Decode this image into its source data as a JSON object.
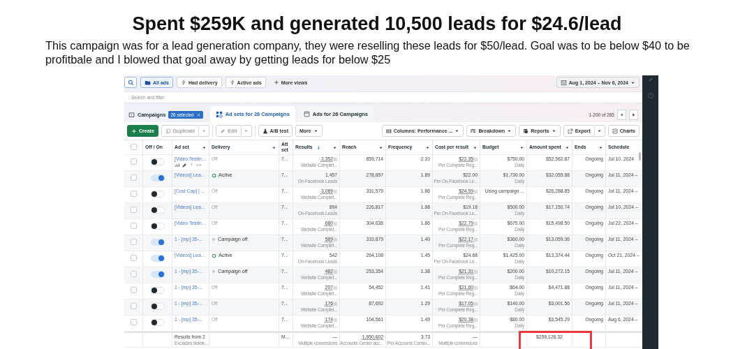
{
  "heading": {
    "title": "Spent $259K and generated 10,500 leads for $24.6/lead",
    "body": "This campaign was for a lead generation company, they were reselling these leads for $50/lead. Goal was to be below $40 to be profitbale and I blowed that goal away by getting leads for below $25"
  },
  "toolbar": {
    "views": [
      {
        "label": "All ads",
        "selected": true
      },
      {
        "label": "Had delivery",
        "selected": false
      },
      {
        "label": "Active ads",
        "selected": false
      },
      {
        "label": "More views",
        "selected": false
      }
    ],
    "date_range": "Aug 1, 2024 – Nov 6, 2024",
    "search": {
      "placeholder": "Search and filter"
    }
  },
  "tabs": {
    "campaigns": {
      "label": "Campaigns",
      "badge": "26 selected"
    },
    "items": [
      {
        "label": "Ad sets for 26 Campaigns",
        "selected": true
      },
      {
        "label": "Ads for 26 Campaigns",
        "selected": false
      }
    ],
    "pager": "1-200 of 265"
  },
  "actions": [
    {
      "label": "Create",
      "kind": "primary",
      "disabled": false
    },
    {
      "label": "Duplicate",
      "kind": "split",
      "disabled": true
    },
    {
      "label": "Edit",
      "kind": "split",
      "disabled": true
    },
    {
      "label": "A/B test",
      "kind": "plain",
      "disabled": false
    },
    {
      "label": "More",
      "kind": "menu",
      "disabled": false
    }
  ],
  "right_actions": [
    {
      "label": "Columns: Performance ...",
      "kind": "menu",
      "disabled": false
    },
    {
      "label": "Breakdown",
      "kind": "menu",
      "disabled": false
    },
    {
      "label": "Reports",
      "kind": "menu",
      "disabled": false
    },
    {
      "label": "Export",
      "kind": "split",
      "disabled": false
    },
    {
      "label": "Charts",
      "kind": "plain",
      "disabled": false
    }
  ],
  "table": {
    "all_checked": false,
    "columns": [
      {
        "label": "Off / On",
        "menu": false,
        "sorted": false
      },
      {
        "label": "Ad set",
        "menu": true,
        "sorted": false
      },
      {
        "label": "Delivery",
        "menu": true,
        "sorted": false
      },
      {
        "label": "Att set",
        "menu": false,
        "sorted": false
      },
      {
        "label": "Results",
        "menu": true,
        "sorted": true
      },
      {
        "label": "Reach",
        "menu": true,
        "sorted": false
      },
      {
        "label": "Frequency",
        "menu": true,
        "sorted": false
      },
      {
        "label": "Cost per result",
        "menu": true,
        "sorted": false
      },
      {
        "label": "Budget",
        "menu": true,
        "sorted": false
      },
      {
        "label": "Amount spent",
        "menu": true,
        "sorted": false
      },
      {
        "label": "Ends",
        "menu": true,
        "sorted": false
      },
      {
        "label": "Schedule",
        "menu": false,
        "sorted": false
      }
    ],
    "rows": [
      {
        "checked": false,
        "on": false,
        "ad_set": "[Video Testin...",
        "tools": true,
        "delivery": {
          "kind": "off",
          "label": "Off"
        },
        "attribution": "7...",
        "results": "2,352",
        "results_note": "Website Complet...",
        "results_info": true,
        "reach": "859,714",
        "frequency": "2.10",
        "cost": "$22.35",
        "cost_note": "Per Complete Reg...",
        "cost_info": true,
        "budget": "$750.00",
        "budget_note": "Daily",
        "spent": "$52,562.87",
        "ends": "Ongoing",
        "schedule": "Jul 10, 2024"
      },
      {
        "checked": false,
        "on": true,
        "ad_set": "[Videos] Lea...",
        "tools": false,
        "delivery": {
          "kind": "active",
          "label": "Active"
        },
        "attribution": "7...",
        "results": "1,457",
        "results_note": "On-Facebook Leads",
        "results_info": false,
        "reach": "278,857",
        "frequency": "1.89",
        "cost": "$22.00",
        "cost_note": "Per On-Facebook Le...",
        "cost_info": false,
        "budget": "$1,730.00",
        "budget_note": "Daily",
        "spent": "$32,055.88",
        "ends": "Ongoing",
        "schedule": "Jul 11, 2024 –"
      },
      {
        "checked": false,
        "on": false,
        "ad_set": "[Cost Cap] | ...",
        "tools": false,
        "delivery": {
          "kind": "off",
          "label": "Off"
        },
        "attribution": "7...",
        "results": "3,069",
        "results_note": "Website Complet...",
        "results_info": true,
        "reach": "331,579",
        "frequency": "1.86",
        "cost": "$24.59",
        "cost_note": "Per Complete Reg...",
        "cost_info": true,
        "budget": "Using campaign ...",
        "spent": "$26,288.85",
        "ends": "Ongoing",
        "schedule": "Jul 11, 2024 –"
      },
      {
        "checked": false,
        "on": false,
        "ad_set": "[Videos] Lea...",
        "tools": false,
        "delivery": {
          "kind": "off",
          "label": "Off"
        },
        "attribution": "7...",
        "results": "894",
        "results_note": "On-Facebook Leads",
        "results_info": false,
        "reach": "226,817",
        "frequency": "1.88",
        "cost": "$19.18",
        "cost_note": "Per On-Facebook Le...",
        "cost_info": false,
        "budget": "$500.00",
        "budget_note": "Daily",
        "spent": "$17,150.74",
        "ends": "Ongoing",
        "schedule": "Jul 10, 2024 –"
      },
      {
        "checked": false,
        "on": false,
        "ad_set": "[Video Testin...",
        "tools": false,
        "delivery": {
          "kind": "off",
          "label": "Off"
        },
        "attribution": "7...",
        "results": "680",
        "results_note": "Website Complet...",
        "results_info": true,
        "reach": "304,638",
        "frequency": "1.86",
        "cost": "$22.79",
        "cost_note": "Per Complete Reg...",
        "cost_info": true,
        "budget": "$675.00",
        "budget_note": "Daily",
        "spent": "$15,498.50",
        "ends": "Ongoing",
        "schedule": "Jul 22, 2024 –"
      },
      {
        "checked": false,
        "on": true,
        "ad_set": "1 - [mp] 35-...",
        "tools": false,
        "delivery": {
          "kind": "campaign_off",
          "label": "Campaign off"
        },
        "attribution": "7...",
        "results": "589",
        "results_note": "Website Complet...",
        "results_info": true,
        "reach": "333,879",
        "frequency": "1.40",
        "cost": "$22.17",
        "cost_note": "Per Complete Reg...",
        "cost_info": true,
        "budget": "$360.00",
        "budget_note": "Daily",
        "spent": "$13,059.36",
        "ends": "Ongoing",
        "schedule": "Jul 11, 2024 –"
      },
      {
        "checked": false,
        "on": true,
        "ad_set": "[Videos] Lea...",
        "tools": false,
        "delivery": {
          "kind": "active",
          "label": "Active"
        },
        "attribution": "7...",
        "results": "542",
        "results_note": "On-Facebook Leads",
        "results_info": false,
        "reach": "264,108",
        "frequency": "1.45",
        "cost": "$24.68",
        "cost_note": "Per On-Facebook Le...",
        "cost_info": false,
        "budget": "$1,425.00",
        "budget_note": "Daily",
        "spent": "$13,374.44",
        "ends": "Ongoing",
        "schedule": "Oct 21, 2024 –"
      },
      {
        "checked": false,
        "on": true,
        "ad_set": "1 - [mp] 35-...",
        "tools": false,
        "delivery": {
          "kind": "campaign_off",
          "label": "Campaign off"
        },
        "attribution": "7...",
        "results": "482",
        "results_note": "Website Complet...",
        "results_info": true,
        "reach": "253,354",
        "frequency": "1.38",
        "cost": "$21.31",
        "cost_note": "Per Complete Reg...",
        "cost_info": true,
        "budget": "$200.00",
        "budget_note": "Daily",
        "spent": "$10,272.15",
        "ends": "Ongoing",
        "schedule": "Jul 11, 2024 –"
      },
      {
        "checked": false,
        "on": false,
        "ad_set": "1 - [mp] 35-...",
        "tools": false,
        "delivery": {
          "kind": "off",
          "label": "Off"
        },
        "attribution": "7...",
        "results": "207",
        "results_note": "Website Complet...",
        "results_info": true,
        "reach": "54,452",
        "frequency": "1.41",
        "cost": "$21.60",
        "cost_note": "Per Complete Reg...",
        "cost_info": true,
        "budget": "$64.00",
        "budget_note": "Daily",
        "spent": "$4,471.88",
        "ends": "Ongoing",
        "schedule": "Jul 11, 2024 –"
      },
      {
        "checked": false,
        "on": false,
        "ad_set": "1 - [mp] 35-...",
        "tools": false,
        "delivery": {
          "kind": "off",
          "label": "Off"
        },
        "attribution": "7...",
        "results": "176",
        "results_note": "Website Complet...",
        "results_info": true,
        "reach": "87,692",
        "frequency": "1.29",
        "cost": "$17.05",
        "cost_note": "Per Complete Reg...",
        "cost_info": true,
        "budget": "$140.00",
        "budget_note": "Daily",
        "spent": "$3,001.56",
        "ends": "Ongoing",
        "schedule": "Jul 11, 2024 –"
      },
      {
        "checked": false,
        "on": false,
        "ad_set": "1 - [mp] 35-...",
        "tools": false,
        "delivery": {
          "kind": "off",
          "label": "Off"
        },
        "attribution": "7...",
        "results": "174",
        "results_note": "Website Complet...",
        "results_info": true,
        "reach": "104,561",
        "frequency": "1.49",
        "cost": "$20.38",
        "cost_note": "Per Complete Reg...",
        "cost_info": true,
        "budget": "$80.00",
        "budget_note": "Daily",
        "spent": "$3,545.29",
        "ends": "Ongoing",
        "schedule": "Aug 6, 2024 –"
      }
    ],
    "totals": {
      "label": "Results from 2",
      "note": "Excludes delete...",
      "attribution": "M...",
      "results": "—",
      "results_note": "Multiple conversions",
      "reach": "1,950,602",
      "reach_note": "Accounts Center acc...",
      "frequency": "3.73",
      "frequency_note": "Per Accounts Center...",
      "cost": "—",
      "cost_note": "Multiple conversions",
      "spent": "$259,126.32",
      "highlighted": true
    }
  }
}
